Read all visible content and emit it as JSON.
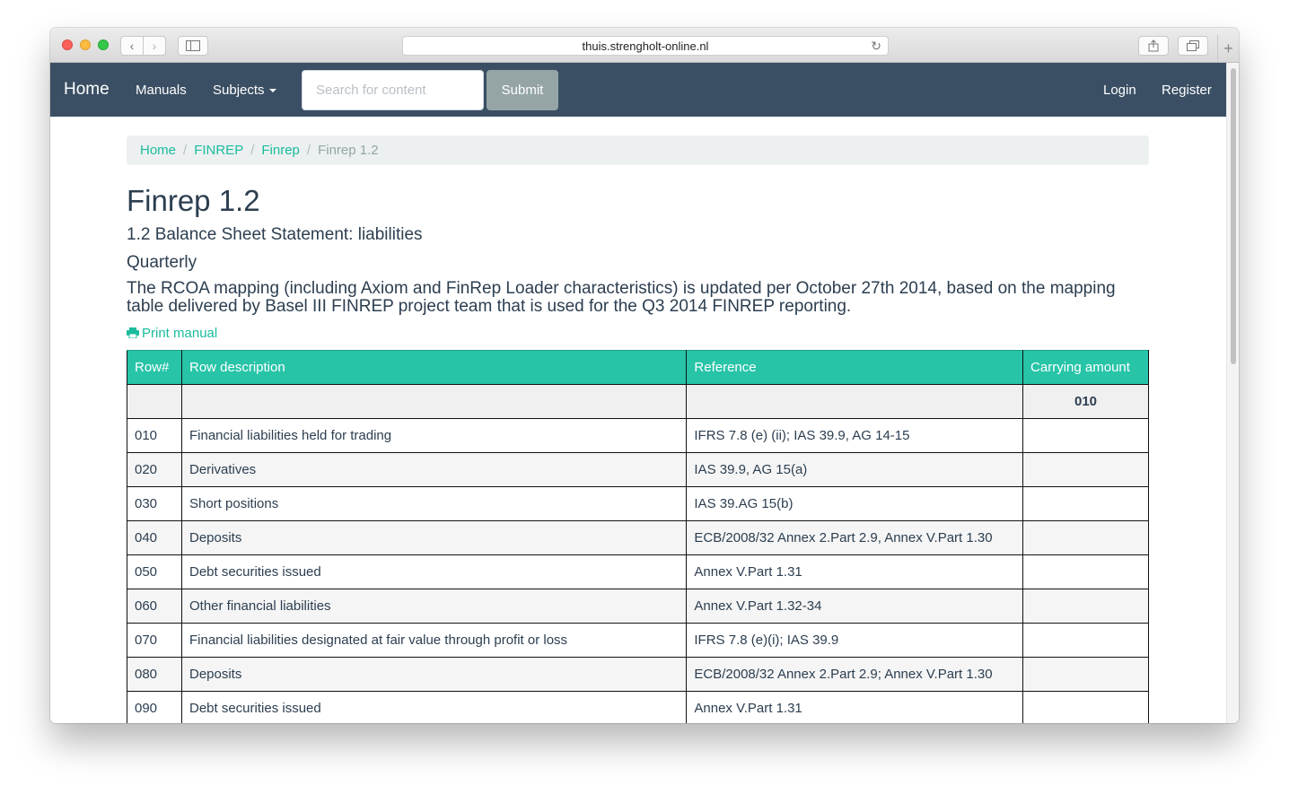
{
  "browser": {
    "url": "thuis.strengholt-online.nl"
  },
  "navbar": {
    "brand": "Home",
    "links": {
      "manuals": "Manuals",
      "subjects": "Subjects",
      "login": "Login",
      "register": "Register"
    },
    "search": {
      "placeholder": "Search for content",
      "submit": "Submit"
    }
  },
  "breadcrumb": {
    "items": [
      "Home",
      "FINREP",
      "Finrep"
    ],
    "active": "Finrep 1.2"
  },
  "page": {
    "title": "Finrep 1.2",
    "subtitle": "1.2 Balance Sheet Statement: liabilities",
    "frequency": "Quarterly",
    "description": "The RCOA mapping (including Axiom and FinRep Loader characteristics) is updated per October 27th 2014, based on the mapping table delivered by Basel III FINREP project team that is used for the Q3 2014 FINREP reporting.",
    "print_label": "Print manual"
  },
  "table": {
    "headers": [
      "Row#",
      "Row description",
      "Reference",
      "Carrying amount"
    ],
    "subheader_amount": "010",
    "rows": [
      {
        "num": "010",
        "desc": "Financial liabilities held for trading",
        "ref": "IFRS 7.8 (e) (ii); IAS 39.9, AG 14-15",
        "amount": ""
      },
      {
        "num": "020",
        "desc": "Derivatives",
        "ref": "IAS 39.9, AG 15(a)",
        "amount": ""
      },
      {
        "num": "030",
        "desc": "Short positions",
        "ref": "IAS 39.AG 15(b)",
        "amount": ""
      },
      {
        "num": "040",
        "desc": "Deposits",
        "ref": "ECB/2008/32 Annex 2.Part 2.9, Annex V.Part 1.30",
        "amount": ""
      },
      {
        "num": "050",
        "desc": "Debt securities issued",
        "ref": "Annex V.Part 1.31",
        "amount": ""
      },
      {
        "num": "060",
        "desc": "Other financial liabilities",
        "ref": "Annex V.Part 1.32-34",
        "amount": ""
      },
      {
        "num": "070",
        "desc": "Financial liabilities designated at fair value through profit or loss",
        "ref": "IFRS 7.8 (e)(i); IAS 39.9",
        "amount": ""
      },
      {
        "num": "080",
        "desc": "Deposits",
        "ref": "ECB/2008/32 Annex 2.Part 2.9; Annex V.Part 1.30",
        "amount": ""
      },
      {
        "num": "090",
        "desc": "Debt securities issued",
        "ref": "Annex V.Part 1.31",
        "amount": ""
      }
    ]
  },
  "colors": {
    "navbar": "#3a4f64",
    "accent": "#1abc9c",
    "table_header": "#27c4a8",
    "text": "#2c3e50"
  }
}
